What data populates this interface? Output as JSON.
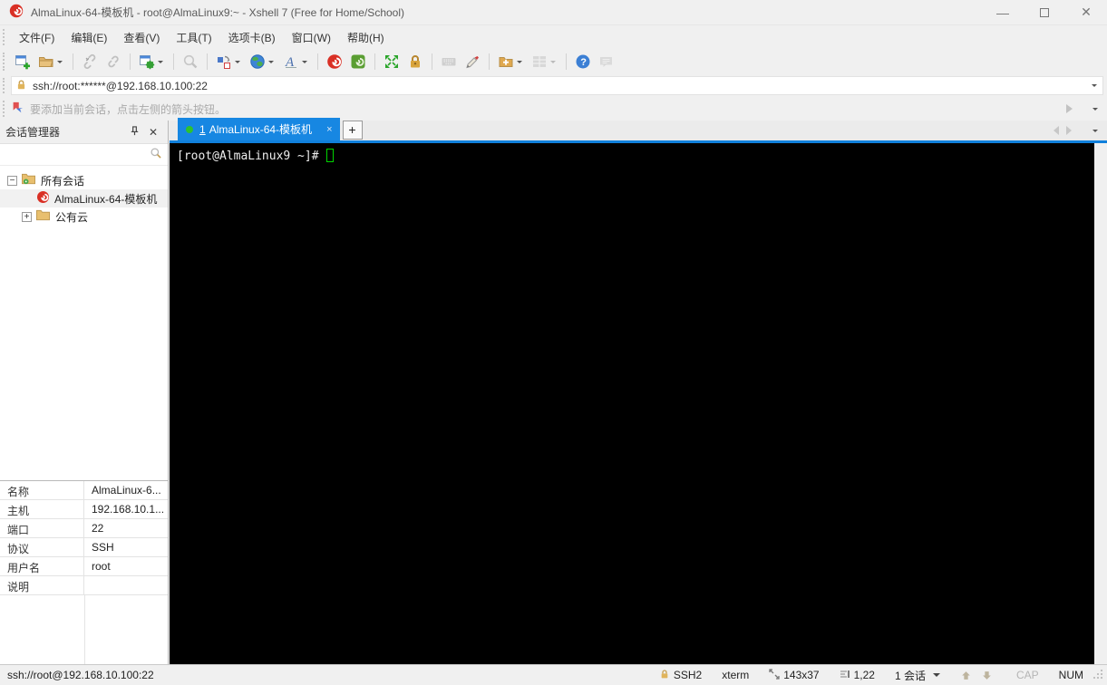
{
  "window": {
    "title": "AlmaLinux-64-模板机 - root@AlmaLinux9:~ - Xshell 7 (Free for Home/School)"
  },
  "menu": {
    "items": [
      "文件(F)",
      "编辑(E)",
      "查看(V)",
      "工具(T)",
      "选项卡(B)",
      "窗口(W)",
      "帮助(H)"
    ]
  },
  "toolbar": {
    "icons": [
      "new-session",
      "open-folder",
      "disconnect",
      "reconnect",
      "session-properties",
      "find",
      "arrange-layout",
      "encoding-globe",
      "font",
      "xshell",
      "xftp",
      "fullscreen",
      "lock",
      "virtual-keyboard",
      "highlight-pen",
      "new-folder",
      "tile-grid",
      "help",
      "feedback"
    ]
  },
  "address_bar": {
    "value": "ssh://root:******@192.168.10.100:22"
  },
  "info_bar": {
    "message": "要添加当前会话，点击左侧的箭头按钮。"
  },
  "session_manager": {
    "title": "会话管理器",
    "tree": [
      {
        "expander": "−",
        "label": "所有会话"
      },
      {
        "label": "AlmaLinux-64-模板机"
      },
      {
        "expander": "+",
        "label": "公有云"
      }
    ],
    "properties": [
      {
        "label": "名称",
        "value": "AlmaLinux-6..."
      },
      {
        "label": "主机",
        "value": "192.168.10.1..."
      },
      {
        "label": "端口",
        "value": "22"
      },
      {
        "label": "协议",
        "value": "SSH"
      },
      {
        "label": "用户名",
        "value": "root"
      },
      {
        "label": "说明",
        "value": ""
      }
    ]
  },
  "tab_bar": {
    "active_tab": {
      "number": "1",
      "label": "AlmaLinux-64-模板机",
      "close": "×"
    },
    "new_tab": "+"
  },
  "terminal": {
    "prompt": "[root@AlmaLinux9 ~]# "
  },
  "status_bar": {
    "url": "ssh://root@192.168.10.100:22",
    "protocol": "SSH2",
    "terminal_type": "xterm",
    "size": "143x37",
    "cursor_position": "1,22",
    "sessions": "1 会话",
    "caps": "CAP",
    "num": "NUM"
  },
  "colors": {
    "accent_blue": "#1787e2",
    "connected_green": "#2ec22e",
    "terminal_bg": "#000000",
    "cursor_green": "#00d400",
    "lock_gold": "#d9a43c",
    "xshell_red": "#d93025",
    "xftp_green": "#5a9e32"
  }
}
